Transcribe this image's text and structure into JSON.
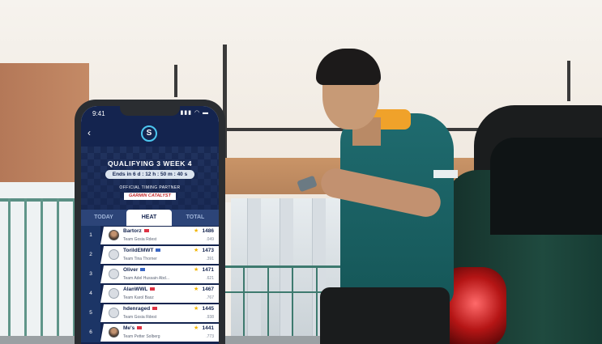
{
  "status_bar": {
    "time": "9:41",
    "icons": "▮▮▮ ◠ ▬"
  },
  "header": {
    "back_icon": "‹",
    "logo_text": "S"
  },
  "event": {
    "title": "QUALIFYING 3 WEEK 4",
    "ends": "Ends in 6 d : 12 h : 50 m : 40 s",
    "official_label": "OFFICIAL TIMING PARTNER",
    "partner": "GARMIN CATALYST"
  },
  "tabs": [
    {
      "label": "TODAY",
      "active": false
    },
    {
      "label": "HEAT",
      "active": true
    },
    {
      "label": "TOTAL",
      "active": false
    }
  ],
  "leaderboard": [
    {
      "rank": "1",
      "name": "Bartorz",
      "team": "Team Gosia Rdest",
      "points": "1486",
      "diff": ".049"
    },
    {
      "rank": "2",
      "name": "TorildEMWT",
      "team": "Team Tina Thorner",
      "points": "1473",
      "diff": ".391"
    },
    {
      "rank": "3",
      "name": "Oliver",
      "team": "Team Adel Hussain Abd...",
      "points": "1471",
      "diff": ".621"
    },
    {
      "rank": "4",
      "name": "AlanWWL",
      "team": "Team Karol Basz",
      "points": "1467",
      "diff": ".767"
    },
    {
      "rank": "5",
      "name": "hdenraged",
      "team": "Team Gosia Rdest",
      "points": "1445",
      "diff": ".938"
    },
    {
      "rank": "6",
      "name": "Me's",
      "team": "Team Petter Solberg",
      "points": "1441",
      "diff": ".773"
    }
  ]
}
